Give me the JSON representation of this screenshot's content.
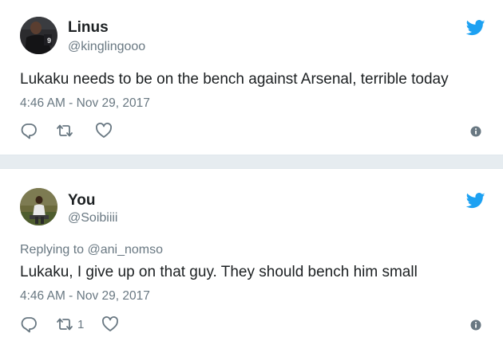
{
  "tweets": [
    {
      "name": "Linus",
      "handle": "@kinglingooo",
      "text": "Lukaku needs to be on the bench against Arsenal, terrible today",
      "timestamp": "4:46 AM - Nov 29, 2017",
      "retweet_count": "",
      "avatar_jersey_number": "9"
    },
    {
      "name": "You",
      "handle": "@Soibiiii",
      "replying_prefix": "Replying to",
      "replying_to": "@ani_nomso",
      "text": "Lukaku, I give up on that guy. They should bench him small",
      "timestamp": "4:46 AM - Nov 29, 2017",
      "retweet_count": "1"
    }
  ],
  "icons": [
    "twitter-bird-icon",
    "reply-icon",
    "retweet-icon",
    "like-icon",
    "info-icon"
  ],
  "colors": {
    "twitter_blue": "#1da1f2",
    "meta_gray": "#697882",
    "text": "#1c2022",
    "background": "#e6ecf0"
  }
}
